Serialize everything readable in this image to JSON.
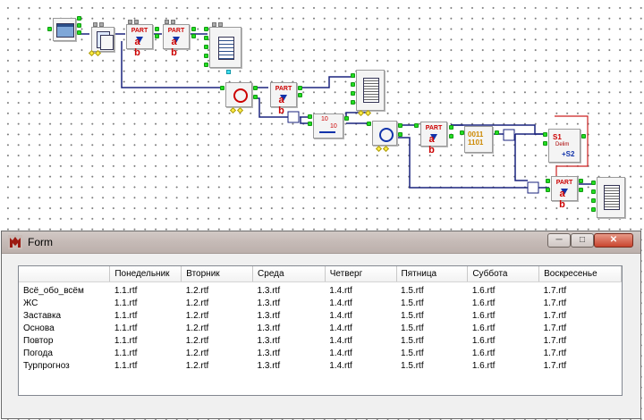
{
  "window": {
    "title": "Form",
    "app_icon": "delphi-icon",
    "controls": {
      "minimize": "minimize-icon",
      "maximize": "maximize-icon",
      "close": "close-icon"
    }
  },
  "canvas": {
    "part_label": "PART",
    "part_ab": "a b",
    "strcat": {
      "s1": "S1",
      "delim": "Delim",
      "s2": "+S2"
    },
    "converter": {
      "top": "0011",
      "bottom": "1101"
    },
    "counter": {
      "a": "10",
      "b": "10"
    }
  },
  "table": {
    "columns": [
      "",
      "Понедельник",
      "Вторник",
      "Среда",
      "Четверг",
      "Пятница",
      "Суббота",
      "Воскресенье"
    ],
    "rows": [
      [
        "Всё_обо_всём",
        "1.1.rtf",
        "1.2.rtf",
        "1.3.rtf",
        "1.4.rtf",
        "1.5.rtf",
        "1.6.rtf",
        "1.7.rtf"
      ],
      [
        "ЖС",
        "1.1.rtf",
        "1.2.rtf",
        "1.3.rtf",
        "1.4.rtf",
        "1.5.rtf",
        "1.6.rtf",
        "1.7.rtf"
      ],
      [
        "Заставка",
        "1.1.rtf",
        "1.2.rtf",
        "1.3.rtf",
        "1.4.rtf",
        "1.5.rtf",
        "1.6.rtf",
        "1.7.rtf"
      ],
      [
        "Основа",
        "1.1.rtf",
        "1.2.rtf",
        "1.3.rtf",
        "1.4.rtf",
        "1.5.rtf",
        "1.6.rtf",
        "1.7.rtf"
      ],
      [
        "Повтор",
        "1.1.rtf",
        "1.2.rtf",
        "1.3.rtf",
        "1.4.rtf",
        "1.5.rtf",
        "1.6.rtf",
        "1.7.rtf"
      ],
      [
        "Погода",
        "1.1.rtf",
        "1.2.rtf",
        "1.3.rtf",
        "1.4.rtf",
        "1.5.rtf",
        "1.6.rtf",
        "1.7.rtf"
      ],
      [
        "Турпрогноз",
        "1.1.rtf",
        "1.2.rtf",
        "1.3.rtf",
        "1.4.rtf",
        "1.5.rtf",
        "1.6.rtf",
        "1.7.rtf"
      ]
    ]
  },
  "colors": {
    "wire": "#1a237e",
    "link_red": "#cc2222",
    "pin_green": "#22dd22"
  }
}
